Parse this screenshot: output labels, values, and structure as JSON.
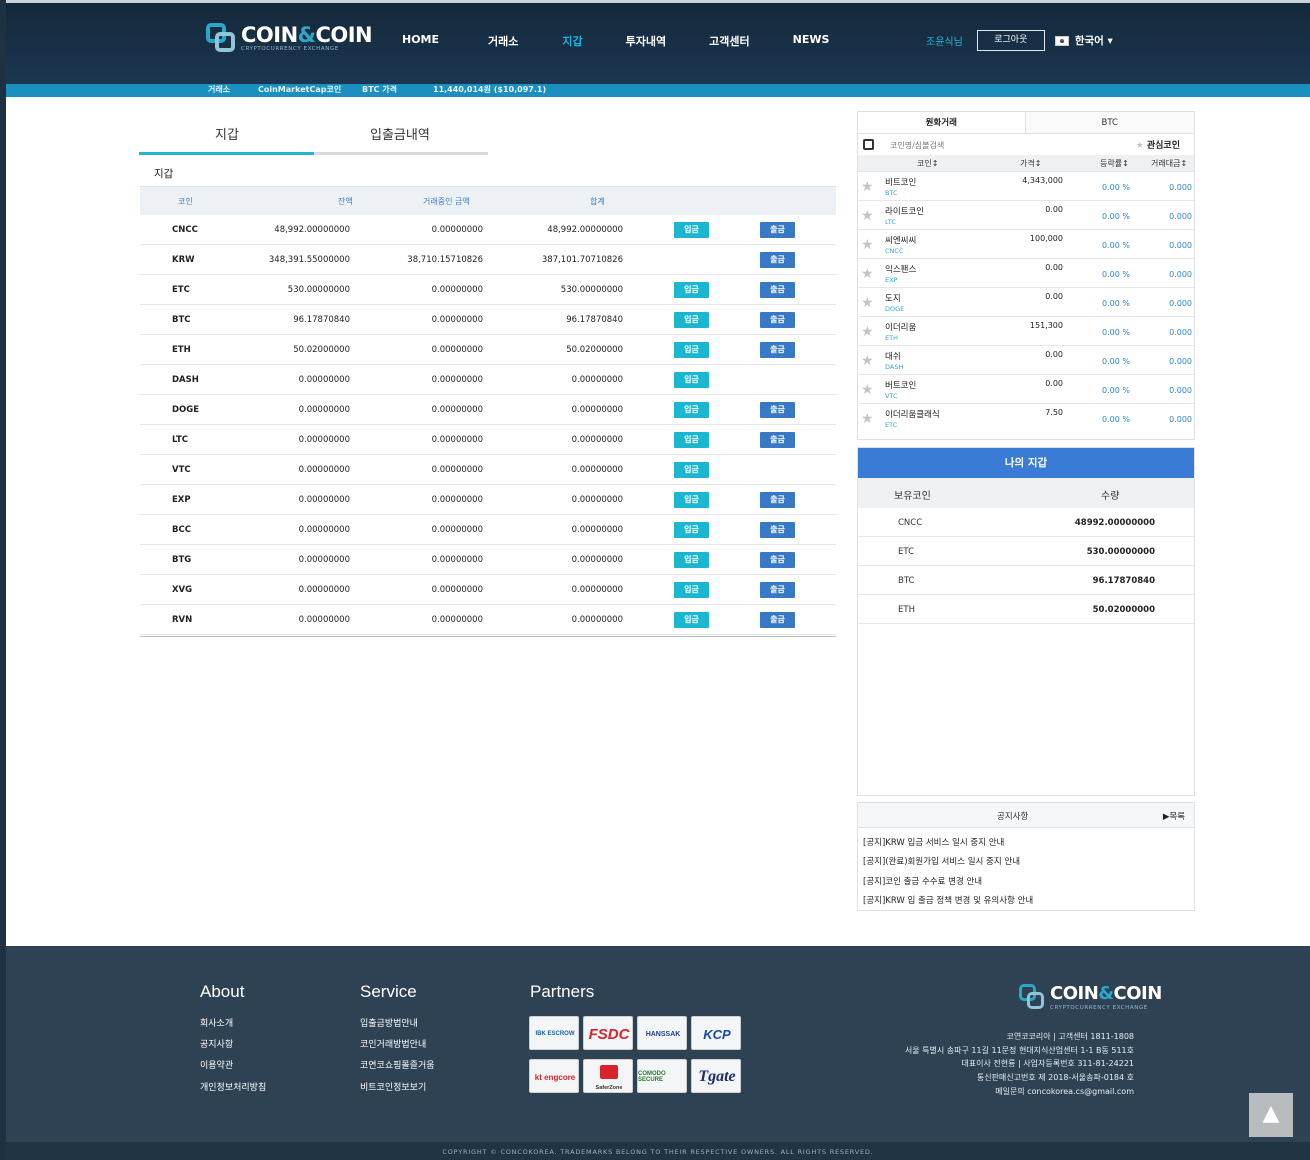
{
  "header": {
    "brand": {
      "name_a": "COIN",
      "name_amp": "&",
      "name_b": "COIN",
      "tagline": "CRYPTOCURRENCY EXCHANGE"
    },
    "nav": [
      {
        "label": "HOME",
        "active": false
      },
      {
        "label": "거래소",
        "active": false
      },
      {
        "label": "지갑",
        "active": true
      },
      {
        "label": "투자내역",
        "active": false
      },
      {
        "label": "고객센터",
        "active": false
      },
      {
        "label": "NEWS",
        "active": false
      }
    ],
    "user_name": "조윤식님",
    "logout_label": "로그아웃",
    "language": "한국어 ▾"
  },
  "ticker": {
    "exchange_label": "거래소",
    "cmc_label": "CoinMarketCap코인",
    "btc_price_label": "BTC 가격",
    "btc_price_value": "11,440,014원 ($10,097.1)"
  },
  "wallet": {
    "tabs": [
      {
        "label": "지갑",
        "active": true
      },
      {
        "label": "입출금내역",
        "active": false
      }
    ],
    "section_label": "지갑",
    "columns": {
      "coin": "코인",
      "balance": "잔액",
      "pending": "거래중인 금액",
      "total": "합계"
    },
    "deposit_label": "입금",
    "withdraw_label": "출금",
    "rows": [
      {
        "coin": "CNCC",
        "balance": "48,992.00000000",
        "pending": "0.00000000",
        "total": "48,992.00000000",
        "deposit": true,
        "withdraw": true
      },
      {
        "coin": "KRW",
        "balance": "348,391.55000000",
        "pending": "38,710.15710826",
        "total": "387,101.70710826",
        "deposit": false,
        "withdraw": true
      },
      {
        "coin": "ETC",
        "balance": "530.00000000",
        "pending": "0.00000000",
        "total": "530.00000000",
        "deposit": true,
        "withdraw": true
      },
      {
        "coin": "BTC",
        "balance": "96.17870840",
        "pending": "0.00000000",
        "total": "96.17870840",
        "deposit": true,
        "withdraw": true
      },
      {
        "coin": "ETH",
        "balance": "50.02000000",
        "pending": "0.00000000",
        "total": "50.02000000",
        "deposit": true,
        "withdraw": true
      },
      {
        "coin": "DASH",
        "balance": "0.00000000",
        "pending": "0.00000000",
        "total": "0.00000000",
        "deposit": true,
        "withdraw": false
      },
      {
        "coin": "DOGE",
        "balance": "0.00000000",
        "pending": "0.00000000",
        "total": "0.00000000",
        "deposit": true,
        "withdraw": true
      },
      {
        "coin": "LTC",
        "balance": "0.00000000",
        "pending": "0.00000000",
        "total": "0.00000000",
        "deposit": true,
        "withdraw": true
      },
      {
        "coin": "VTC",
        "balance": "0.00000000",
        "pending": "0.00000000",
        "total": "0.00000000",
        "deposit": true,
        "withdraw": false
      },
      {
        "coin": "EXP",
        "balance": "0.00000000",
        "pending": "0.00000000",
        "total": "0.00000000",
        "deposit": true,
        "withdraw": true
      },
      {
        "coin": "BCC",
        "balance": "0.00000000",
        "pending": "0.00000000",
        "total": "0.00000000",
        "deposit": true,
        "withdraw": true
      },
      {
        "coin": "BTG",
        "balance": "0.00000000",
        "pending": "0.00000000",
        "total": "0.00000000",
        "deposit": true,
        "withdraw": true
      },
      {
        "coin": "XVG",
        "balance": "0.00000000",
        "pending": "0.00000000",
        "total": "0.00000000",
        "deposit": true,
        "withdraw": true
      },
      {
        "coin": "RVN",
        "balance": "0.00000000",
        "pending": "0.00000000",
        "total": "0.00000000",
        "deposit": true,
        "withdraw": true
      }
    ]
  },
  "market": {
    "tabs": [
      {
        "label": "원화거래",
        "active": true
      },
      {
        "label": "BTC",
        "active": false
      }
    ],
    "search_placeholder": "코인명/심볼검색",
    "fav_label": "관심코인",
    "columns": {
      "coin": "코인↕",
      "price": "가격↕",
      "change": "등락률↕",
      "volume": "거래대금↕"
    },
    "rows": [
      {
        "name": "비트코인",
        "symbol": "BTC",
        "price": "4,343,000",
        "change": "0.00 %",
        "volume": "0.000"
      },
      {
        "name": "라이트코인",
        "symbol": "LTC",
        "price": "0.00",
        "change": "0.00 %",
        "volume": "0.000"
      },
      {
        "name": "씨엔씨씨",
        "symbol": "CNCC",
        "price": "100,000",
        "change": "0.00 %",
        "volume": "0.000"
      },
      {
        "name": "익스팬스",
        "symbol": "EXP",
        "price": "0.00",
        "change": "0.00 %",
        "volume": "0.000"
      },
      {
        "name": "도지",
        "symbol": "DOGE",
        "price": "0.00",
        "change": "0.00 %",
        "volume": "0.000"
      },
      {
        "name": "이더리움",
        "symbol": "ETH",
        "price": "151,300",
        "change": "0.00 %",
        "volume": "0.000"
      },
      {
        "name": "대쉬",
        "symbol": "DASH",
        "price": "0.00",
        "change": "0.00 %",
        "volume": "0.000"
      },
      {
        "name": "버트코인",
        "symbol": "VTC",
        "price": "0.00",
        "change": "0.00 %",
        "volume": "0.000"
      },
      {
        "name": "이더리움클래식",
        "symbol": "ETC",
        "price": "7.50",
        "change": "0.00 %",
        "volume": "0.000"
      }
    ]
  },
  "my_wallet": {
    "title": "나의 지갑",
    "col_coin": "보유코인",
    "col_amount": "수량",
    "rows": [
      {
        "coin": "CNCC",
        "amount": "48992.00000000"
      },
      {
        "coin": "ETC",
        "amount": "530.00000000"
      },
      {
        "coin": "BTC",
        "amount": "96.17870840"
      },
      {
        "coin": "ETH",
        "amount": "50.02000000"
      }
    ]
  },
  "notice": {
    "title": "공지사항",
    "more_label": "▶목록",
    "items": [
      "[공지]KRW 입금 서비스 일시 중지 안내",
      "[공지](완료)회원가입 서비스 일시 중지 안내",
      "[공지]코인 출금 수수료 변경 안내",
      "[공지]KRW 입 출금 정책 변경 및 유의사항 안내"
    ]
  },
  "footer": {
    "about": {
      "title": "About",
      "links": [
        "회사소개",
        "공지사항",
        "이용약관",
        "개인정보처리방침"
      ]
    },
    "service": {
      "title": "Service",
      "links": [
        "입출금방법안내",
        "코인거래방법안내",
        "코연코쇼핑몰즐거움",
        "비트코인정보보기"
      ]
    },
    "partners": {
      "title": "Partners",
      "logos": [
        "IBK ESCROW",
        "FSDC",
        "HANSSAK",
        "KCP",
        "kt engcore",
        "SaferZone",
        "COMODO SECURE",
        "Tgate"
      ]
    },
    "info_lines": [
      "코연코코리아 | 고객센터 1811-1808",
      "서울 특별시 송파구 11길 11문정 현대지식산업센터 1-1 B동 511호",
      "대표이사 전현룡 | 사업자등록번호 311-81-24221",
      "통신판매신고번호 제 2018-서울송파-0184 호",
      "메일문의 concokorea.cs@gmail.com"
    ],
    "copyright": "COPYRIGHT © CONCOKOREA. TRADEMARKS BELONG TO THEIR RESPECTIVE OWNERS. ALL RIGHTS RESERVED.",
    "top_icon": "arrow-up-icon"
  }
}
